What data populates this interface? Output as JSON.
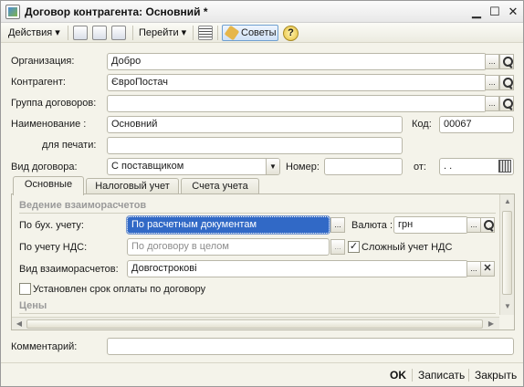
{
  "window": {
    "title": "Договор контрагента: Основний *"
  },
  "toolbar": {
    "actions": "Действия",
    "goto": "Перейти",
    "tips": "Советы",
    "help": "?"
  },
  "form": {
    "organization": {
      "label": "Организация:",
      "value": "Добро"
    },
    "counterparty": {
      "label": "Контрагент:",
      "value": "ЄвроПостач"
    },
    "contract_group": {
      "label": "Группа договоров:",
      "value": ""
    },
    "name": {
      "label": "Наименование :",
      "value": "Основний"
    },
    "code": {
      "label": "Код:",
      "value": "00067"
    },
    "print_name": {
      "label": "для печати:",
      "value": ""
    },
    "contract_type": {
      "label": "Вид договора:",
      "value": "С поставщиком"
    },
    "number": {
      "label": "Номер:",
      "value": ""
    },
    "date": {
      "label": "от:",
      "value": " .  ."
    }
  },
  "tabs": [
    "Основные",
    "Налоговый учет",
    "Счета учета"
  ],
  "main_tab": {
    "section_settlements": "Ведение взаиморасчетов",
    "accounting": {
      "label": "По бух. учету:",
      "value": "По расчетным документам"
    },
    "currency": {
      "label": "Валюта :",
      "value": "грн"
    },
    "vat": {
      "label": "По учету НДС:",
      "value": "По договору в целом"
    },
    "complex_vat": {
      "label": "Сложный  учет НДС",
      "checked": true
    },
    "settlement_type": {
      "label": "Вид взаиморасчетов:",
      "value": "Довгострокові"
    },
    "payment_term": {
      "label": "Установлен срок оплаты по договору",
      "checked": false
    },
    "section_prices": "Цены"
  },
  "comment": {
    "label": "Комментарий:",
    "value": ""
  },
  "footer": {
    "ok": "OK",
    "save": "Записать",
    "close": "Закрыть"
  }
}
